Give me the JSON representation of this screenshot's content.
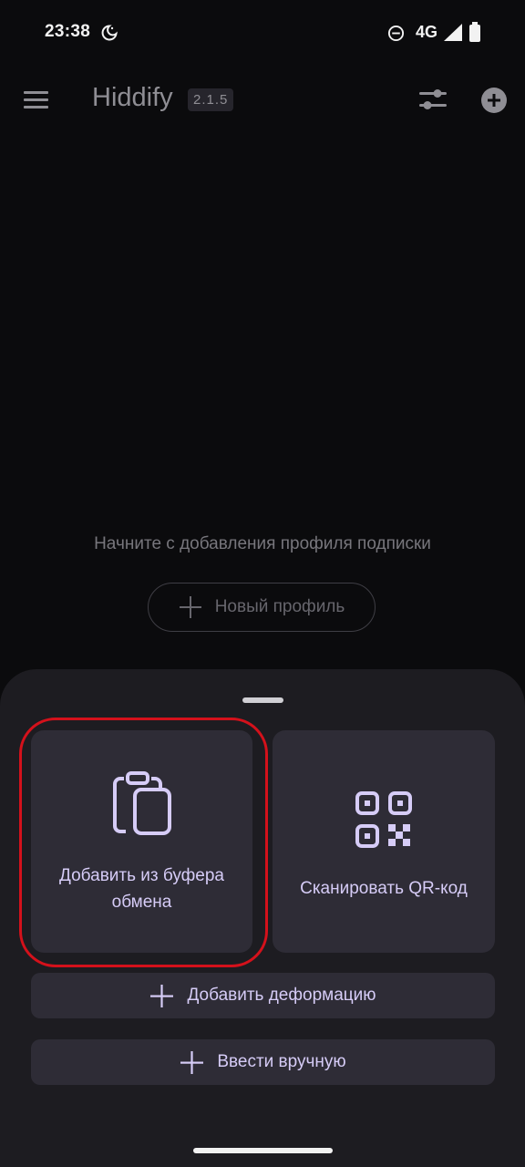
{
  "status_bar": {
    "time": "23:38",
    "network": "4G",
    "icons": [
      "moon-icon",
      "do-not-disturb-icon",
      "signal-icon",
      "battery-icon"
    ]
  },
  "app_bar": {
    "title": "Hiddify",
    "version": "2.1.5",
    "icons": [
      "menu-icon",
      "filter-icon",
      "add-circle-icon"
    ]
  },
  "empty_state": {
    "message": "Начните с добавления профиля подписки",
    "new_profile_label": "Новый профиль"
  },
  "bottom_sheet": {
    "clipboard_label_line1": "Добавить из буфера",
    "clipboard_label_line2": "обмена",
    "qr_label": "Сканировать QR-код",
    "add_deformation_label": "Добавить деформацию",
    "manual_entry_label": "Ввести вручную"
  },
  "colors": {
    "background": "#0b0b0d",
    "sheet": "#1d1c21",
    "tile": "#2e2c36",
    "accent": "#d6ccf7",
    "highlight": "#d4111b"
  }
}
